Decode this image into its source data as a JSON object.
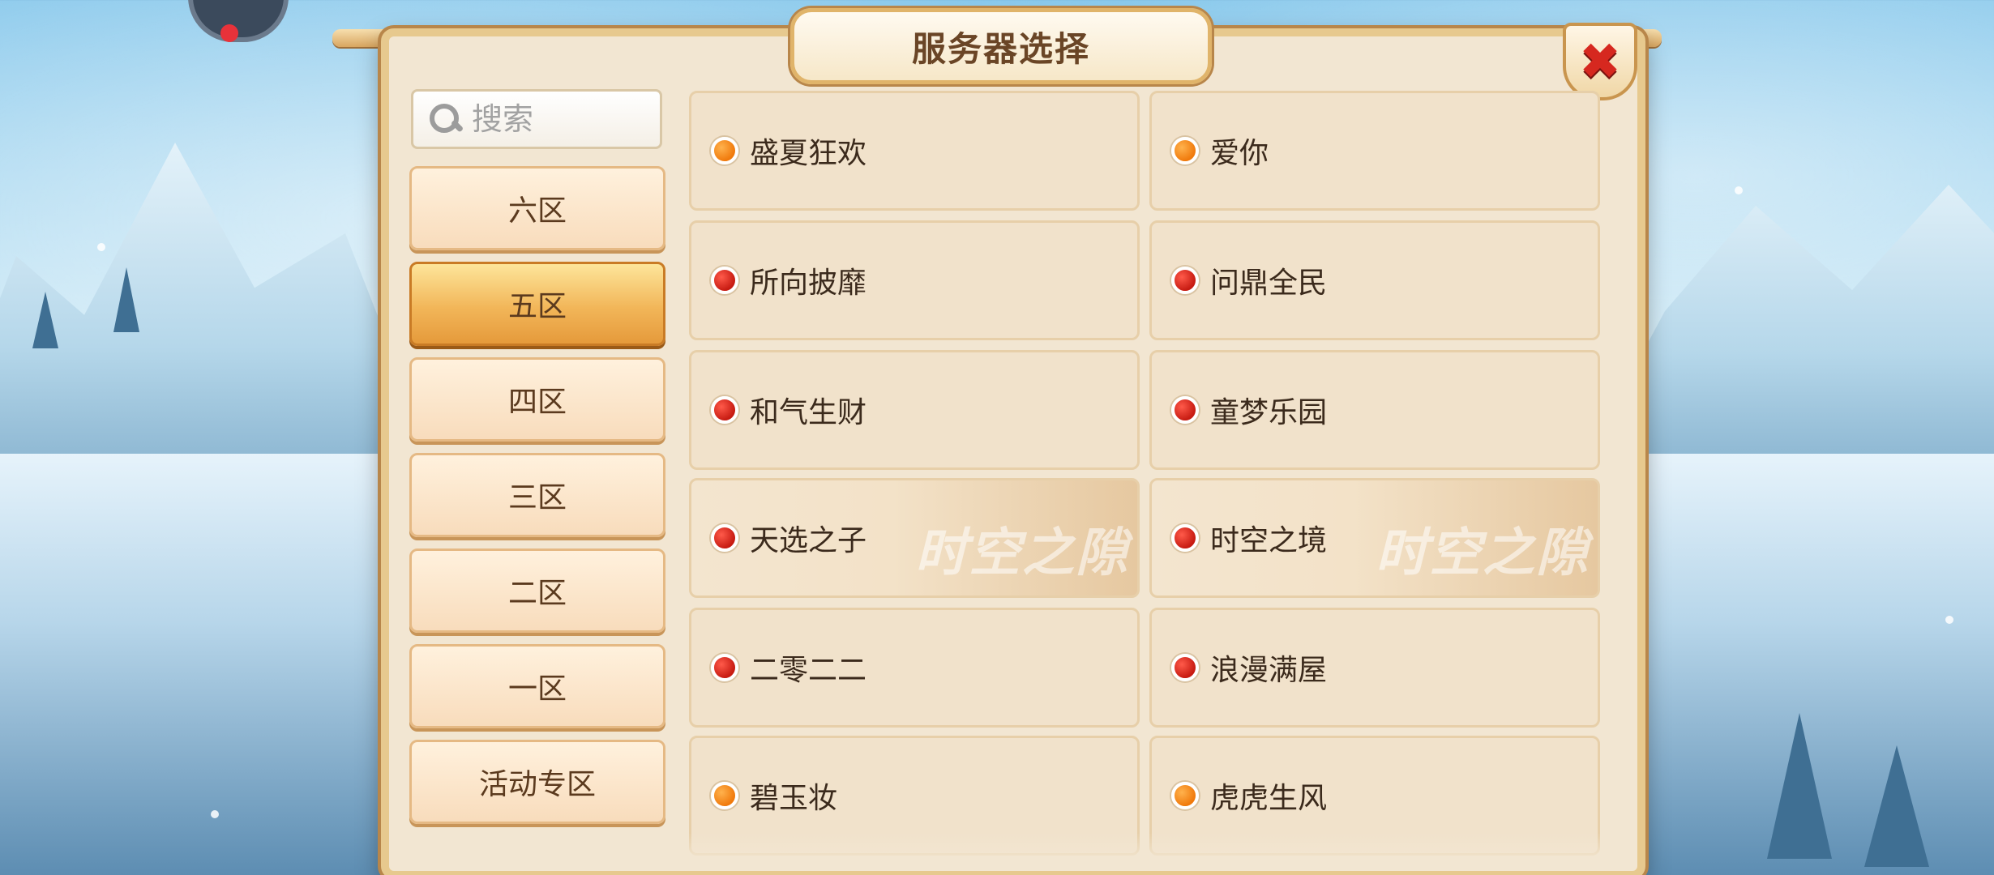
{
  "title": "服务器选择",
  "search": {
    "placeholder": "搜索"
  },
  "zones": [
    {
      "label": "六区",
      "active": false
    },
    {
      "label": "五区",
      "active": true
    },
    {
      "label": "四区",
      "active": false
    },
    {
      "label": "三区",
      "active": false
    },
    {
      "label": "二区",
      "active": false
    },
    {
      "label": "一区",
      "active": false
    },
    {
      "label": "活动专区",
      "active": false
    }
  ],
  "servers": [
    {
      "name": "盛夏狂欢",
      "status": "orange"
    },
    {
      "name": "爱你",
      "status": "orange"
    },
    {
      "name": "所向披靡",
      "status": "red"
    },
    {
      "name": "问鼎全民",
      "status": "red"
    },
    {
      "name": "和气生财",
      "status": "red"
    },
    {
      "name": "童梦乐园",
      "status": "red"
    },
    {
      "name": "天选之子",
      "status": "red",
      "watermark": "时空之隙"
    },
    {
      "name": "时空之境",
      "status": "red",
      "watermark": "时空之隙"
    },
    {
      "name": "二零二二",
      "status": "red"
    },
    {
      "name": "浪漫满屋",
      "status": "red"
    },
    {
      "name": "碧玉妆",
      "status": "orange"
    },
    {
      "name": "虎虎生风",
      "status": "orange"
    }
  ],
  "colors": {
    "status_orange": "#f07a0c",
    "status_red": "#c71b12",
    "active_zone": "#f2b659",
    "close_x": "#d6281f"
  },
  "icons": {
    "close": "close-icon",
    "search": "search-icon"
  }
}
